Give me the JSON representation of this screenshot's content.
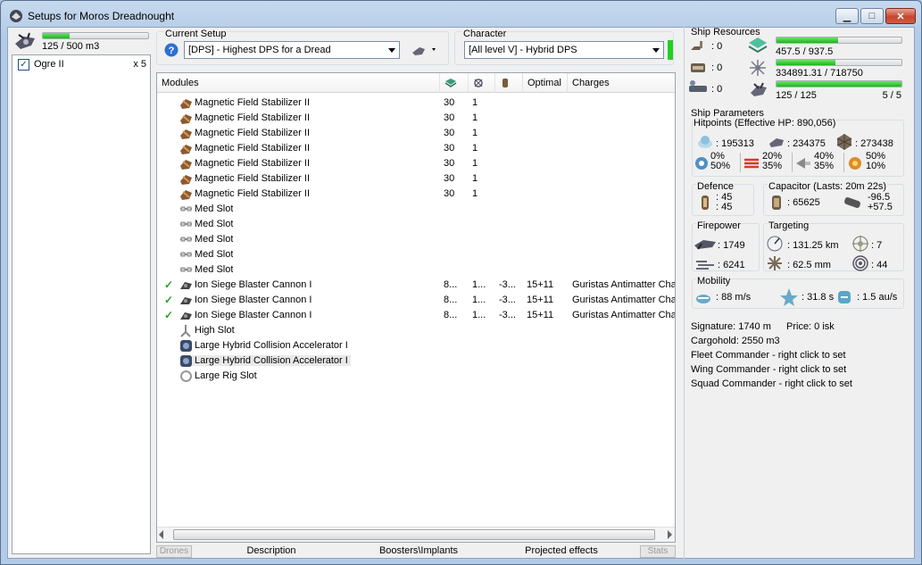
{
  "window": {
    "title": "Setups for Moros Dreadnought",
    "minimize": "▁",
    "maximize": "□",
    "close": "✕"
  },
  "drones": {
    "capacity": "125 / 500 m3",
    "capacity_fraction": 0.25,
    "items": [
      {
        "name": "Ogre II",
        "qty": "x 5",
        "checked": true
      }
    ]
  },
  "setup": {
    "label": "Current Setup",
    "value": "[DPS] - Highest DPS for a Dread"
  },
  "character": {
    "label": "Character",
    "value": "[All level V] - Hybrid DPS"
  },
  "modules": {
    "headers": [
      "Modules",
      "",
      "",
      "",
      "Optimal",
      "Charges"
    ],
    "rows": [
      {
        "icon": "damage-mod-icon",
        "name": "Magnetic Field Stabilizer II",
        "c1": "30",
        "c2": "1",
        "c3": "",
        "optimal": "",
        "charges": "",
        "active": false
      },
      {
        "icon": "damage-mod-icon",
        "name": "Magnetic Field Stabilizer II",
        "c1": "30",
        "c2": "1",
        "c3": "",
        "optimal": "",
        "charges": "",
        "active": false
      },
      {
        "icon": "damage-mod-icon",
        "name": "Magnetic Field Stabilizer II",
        "c1": "30",
        "c2": "1",
        "c3": "",
        "optimal": "",
        "charges": "",
        "active": false
      },
      {
        "icon": "damage-mod-icon",
        "name": "Magnetic Field Stabilizer II",
        "c1": "30",
        "c2": "1",
        "c3": "",
        "optimal": "",
        "charges": "",
        "active": false
      },
      {
        "icon": "damage-mod-icon",
        "name": "Magnetic Field Stabilizer II",
        "c1": "30",
        "c2": "1",
        "c3": "",
        "optimal": "",
        "charges": "",
        "active": false
      },
      {
        "icon": "damage-mod-icon",
        "name": "Magnetic Field Stabilizer II",
        "c1": "30",
        "c2": "1",
        "c3": "",
        "optimal": "",
        "charges": "",
        "active": false
      },
      {
        "icon": "damage-mod-icon",
        "name": "Magnetic Field Stabilizer II",
        "c1": "30",
        "c2": "1",
        "c3": "",
        "optimal": "",
        "charges": "",
        "active": false
      },
      {
        "icon": "med-slot-icon",
        "name": "Med Slot",
        "c1": "",
        "c2": "",
        "c3": "",
        "optimal": "",
        "charges": "",
        "active": false
      },
      {
        "icon": "med-slot-icon",
        "name": "Med Slot",
        "c1": "",
        "c2": "",
        "c3": "",
        "optimal": "",
        "charges": "",
        "active": false
      },
      {
        "icon": "med-slot-icon",
        "name": "Med Slot",
        "c1": "",
        "c2": "",
        "c3": "",
        "optimal": "",
        "charges": "",
        "active": false
      },
      {
        "icon": "med-slot-icon",
        "name": "Med Slot",
        "c1": "",
        "c2": "",
        "c3": "",
        "optimal": "",
        "charges": "",
        "active": false
      },
      {
        "icon": "med-slot-icon",
        "name": "Med Slot",
        "c1": "",
        "c2": "",
        "c3": "",
        "optimal": "",
        "charges": "",
        "active": false
      },
      {
        "icon": "turret-icon",
        "name": "Ion Siege Blaster Cannon I",
        "c1": "8...",
        "c2": "1...",
        "c3": "-3...",
        "optimal": "15+11",
        "charges": "Guristas Antimatter Charg",
        "active": true
      },
      {
        "icon": "turret-icon",
        "name": "Ion Siege Blaster Cannon I",
        "c1": "8...",
        "c2": "1...",
        "c3": "-3...",
        "optimal": "15+11",
        "charges": "Guristas Antimatter Charg",
        "active": true
      },
      {
        "icon": "turret-icon",
        "name": "Ion Siege Blaster Cannon I",
        "c1": "8...",
        "c2": "1...",
        "c3": "-3...",
        "optimal": "15+11",
        "charges": "Guristas Antimatter Charg",
        "active": true
      },
      {
        "icon": "high-slot-icon",
        "name": "High Slot",
        "c1": "",
        "c2": "",
        "c3": "",
        "optimal": "",
        "charges": "",
        "active": false
      },
      {
        "icon": "rig-icon",
        "name": "Large Hybrid Collision Accelerator I",
        "c1": "",
        "c2": "",
        "c3": "",
        "optimal": "",
        "charges": "",
        "active": false
      },
      {
        "icon": "rig-icon",
        "name": "Large Hybrid Collision Accelerator I",
        "c1": "",
        "c2": "",
        "c3": "",
        "optimal": "",
        "charges": "",
        "active": false,
        "selected": true
      },
      {
        "icon": "rig-slot-icon",
        "name": "Large Rig Slot",
        "c1": "",
        "c2": "",
        "c3": "",
        "optimal": "",
        "charges": "",
        "active": false
      }
    ]
  },
  "tabs": [
    "Drones",
    "Description",
    "Boosters\\Implants",
    "Projected effects",
    "Stats"
  ],
  "resources": {
    "label": "Ship Resources",
    "turret_slots": ": 0",
    "launcher_slots": ": 0",
    "calibration": ": 0",
    "cpu": "457.5 / 937.5",
    "cpu_fraction": 0.49,
    "powergrid": "334891.31 / 718750",
    "powergrid_fraction": 0.47,
    "drone_bay": "125 / 125",
    "drone_bay_fraction": 1.0,
    "drones_active": "5 / 5"
  },
  "parameters": {
    "label": "Ship Parameters",
    "hitpoints_label": "Hitpoints (Effective HP: 890,056)",
    "shield_hp": ": 195313",
    "armor_hp": ": 234375",
    "hull_hp": ": 273438",
    "resist": [
      {
        "icon": "em-icon",
        "a": "0%",
        "b": "50%"
      },
      {
        "icon": "thermal-icon",
        "a": "20%",
        "b": "35%"
      },
      {
        "icon": "kinetic-icon",
        "a": "40%",
        "b": "35%"
      },
      {
        "icon": "explosive-icon",
        "a": "50%",
        "b": "10%"
      }
    ],
    "defence_label": "Defence",
    "def_a": ": 45",
    "def_b": ": 45",
    "capacitor_label": "Capacitor (Lasts: 20m 22s)",
    "cap_amount": ": 65625",
    "cap_a": "-96.5",
    "cap_b": "+57.5",
    "firepower_label": "Firepower",
    "fire_a": ": 1749",
    "fire_b": ": 6241",
    "targeting_label": "Targeting",
    "range": ": 131.25 km",
    "max_targets": ": 7",
    "scan_res": ": 62.5 mm",
    "sensor": ": 44",
    "mobility_label": "Mobility",
    "speed": ": 88 m/s",
    "align": ": 31.8 s",
    "warp": ": 1.5 au/s"
  },
  "misc": {
    "signature": "Signature: 1740 m",
    "price": "Price: 0 isk",
    "cargohold": "Cargohold: 2550 m3",
    "fleet": "Fleet Commander - right click to set",
    "wing": "Wing Commander - right click to set",
    "squad": "Squad Commander - right click to set"
  },
  "colors": {
    "bar": "#19b719",
    "accent": "#2aa02a"
  }
}
